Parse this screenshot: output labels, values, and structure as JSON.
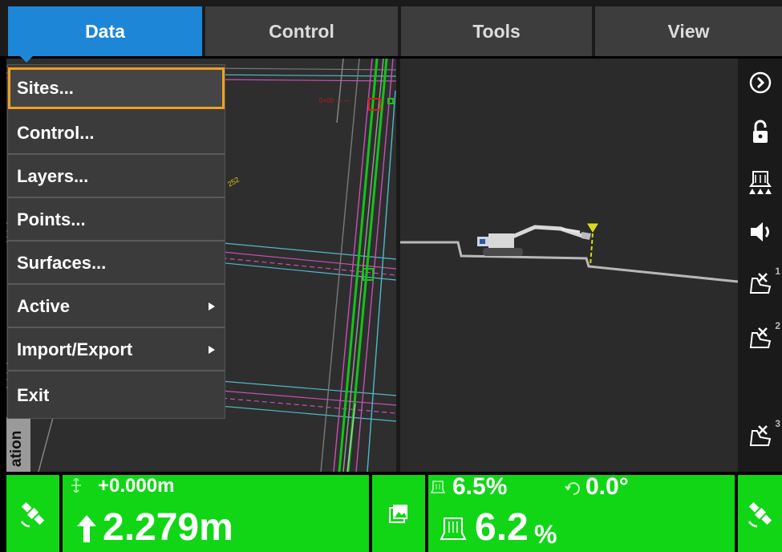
{
  "tabs": [
    {
      "label": "Data",
      "active": true
    },
    {
      "label": "Control",
      "active": false
    },
    {
      "label": "Tools",
      "active": false
    },
    {
      "label": "View",
      "active": false
    }
  ],
  "data_menu": {
    "items": [
      {
        "label": "Sites...",
        "selected": true,
        "has_submenu": false
      },
      {
        "label": "Control...",
        "selected": false,
        "has_submenu": false
      },
      {
        "label": "Layers...",
        "selected": false,
        "has_submenu": false
      },
      {
        "label": "Points...",
        "selected": false,
        "has_submenu": false
      },
      {
        "label": "Surfaces...",
        "selected": false,
        "has_submenu": false
      },
      {
        "label": "Active",
        "selected": false,
        "has_submenu": true
      },
      {
        "label": "Import/Export",
        "selected": false,
        "has_submenu": true
      },
      {
        "label": "Exit",
        "selected": false,
        "has_submenu": false
      }
    ]
  },
  "plan_view": {
    "side_tab_label": "ation",
    "design_label": "252"
  },
  "toolbar": {
    "buttons": [
      {
        "icon": "chevron-circle-right-icon"
      },
      {
        "icon": "unlock-icon"
      },
      {
        "icon": "bucket-teeth-icon"
      },
      {
        "icon": "speaker-icon"
      },
      {
        "icon": "bucket-point-icon",
        "superscript": "1"
      },
      {
        "icon": "bucket-point-icon",
        "superscript": "2"
      },
      {
        "icon": "bucket-point-icon",
        "superscript": "3"
      }
    ]
  },
  "status": {
    "offset": "+0.000m",
    "cut_fill": "2.279m",
    "slope_small": "6.5%",
    "rotation": "0.0°",
    "slope_large": "6.2",
    "slope_large_unit": "%"
  },
  "colors": {
    "active_tab": "#1e86d6",
    "selection": "#f0a020",
    "status_green": "#10d616"
  }
}
